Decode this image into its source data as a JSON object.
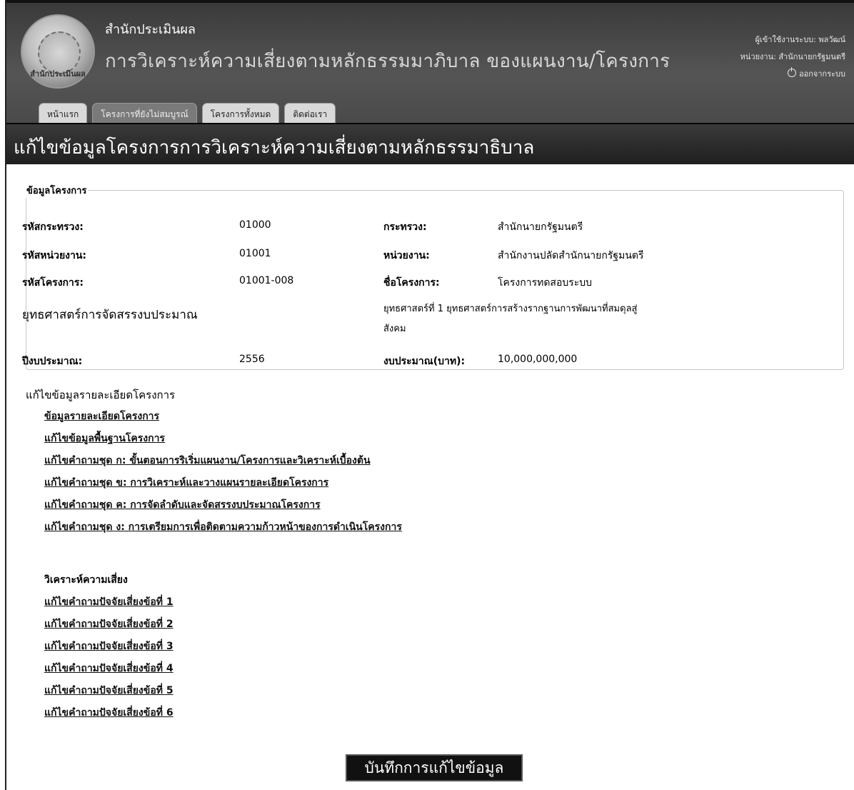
{
  "header": {
    "org_name": "สำนักประเมินผล",
    "app_title": "การวิเคราะห์ความเสี่ยงตามหลักธรรมมาภิบาล ของแผนงาน/โครงการ",
    "seal_text": "สำนักประเมินผล",
    "user_label": "ผู้เข้าใช้งานระบบ: พลวัฒน์",
    "unit_label": "หน่วยงาน: สำนักนายกรัฐมนตรี",
    "logout_label": "ออกจากระบบ"
  },
  "tabs": [
    {
      "label": "หน้าแรก",
      "active": false
    },
    {
      "label": "โครงการที่ยังไม่สมบูรณ์",
      "active": true
    },
    {
      "label": "โครงการทั้งหมด",
      "active": false
    },
    {
      "label": "ติดต่อเรา",
      "active": false
    }
  ],
  "page_title": "แก้ไขข้อมูลโครงการการวิเคราะห์ความเสี่ยงตามหลักธรรมาธิบาล",
  "project_info": {
    "legend": "ข้อมูลโครงการ",
    "ministry_code_label": "รหัสกระทรวง:",
    "ministry_code": "01000",
    "ministry_label": "กระทรวง:",
    "ministry": "สำนักนายกรัฐมนตรี",
    "unit_code_label": "รหัสหน่วยงาน:",
    "unit_code": "01001",
    "unit_label": "หน่วยงาน:",
    "unit": "สำนักงานปลัดสำนักนายกรัฐมนตรี",
    "project_code_label": "รหัสโครงการ:",
    "project_code": "01001-008",
    "project_name_label": "ชื่อโครงการ:",
    "project_name": "โครงการทดสอบระบบ",
    "strategy_label": "ยุทธศาสตร์การจัดสรรงบประมาณ",
    "strategy_line1": "ยุทธศาสตร์ที่ 1 ยุทธศาสตร์การสร้างรากฐานการพัฒนาที่สมดุลสู่",
    "strategy_line2": "สังคม",
    "fiscal_year_label": "ปีงบประมาณ:",
    "fiscal_year": "2556",
    "budget_label": "งบประมาณ(บาท):",
    "budget": "10,000,000,000"
  },
  "edit_section": {
    "title": "แก้ไขข้อมูลรายละเอียดโครงการ",
    "links": [
      "ข้อมูลรายละเอียดโครงการ",
      "แก้ไขข้อมูลพื้นฐานโครงการ",
      "แก้ไขคำถามชุด ก: ขั้นตอนการริเริ่มแผนงาน/โครงการและวิเคราะห์เบื้องต้น",
      "แก้ไขคำถามชุด ข: การวิเคราะห์และวางแผนรายละเอียดโครงการ",
      "แก้ไขคำถามชุด ค: การจัดลำดับและจัดสรรงบประมาณโครงการ",
      "แก้ไขคำถามชุด ง: การเตรียมการเพื่อติดตามความก้าวหน้าของการดำเนินโครงการ"
    ]
  },
  "risk_section": {
    "title": "วิเคราะห์ความเสี่ยง",
    "links": [
      "แก้ไขคำถามปัจจัยเสี่ยงข้อที่ 1",
      "แก้ไขคำถามปัจจัยเสี่ยงข้อที่ 2",
      "แก้ไขคำถามปัจจัยเสี่ยงข้อที่ 3",
      "แก้ไขคำถามปัจจัยเสี่ยงข้อที่ 4",
      "แก้ไขคำถามปัจจัยเสี่ยงข้อที่ 5",
      "แก้ไขคำถามปัจจัยเสี่ยงข้อที่ 6"
    ]
  },
  "save_button_label": "บันทึกการแก้ไขข้อมูล",
  "icons": {
    "logout": "power-icon",
    "logo": "seal-logo"
  }
}
